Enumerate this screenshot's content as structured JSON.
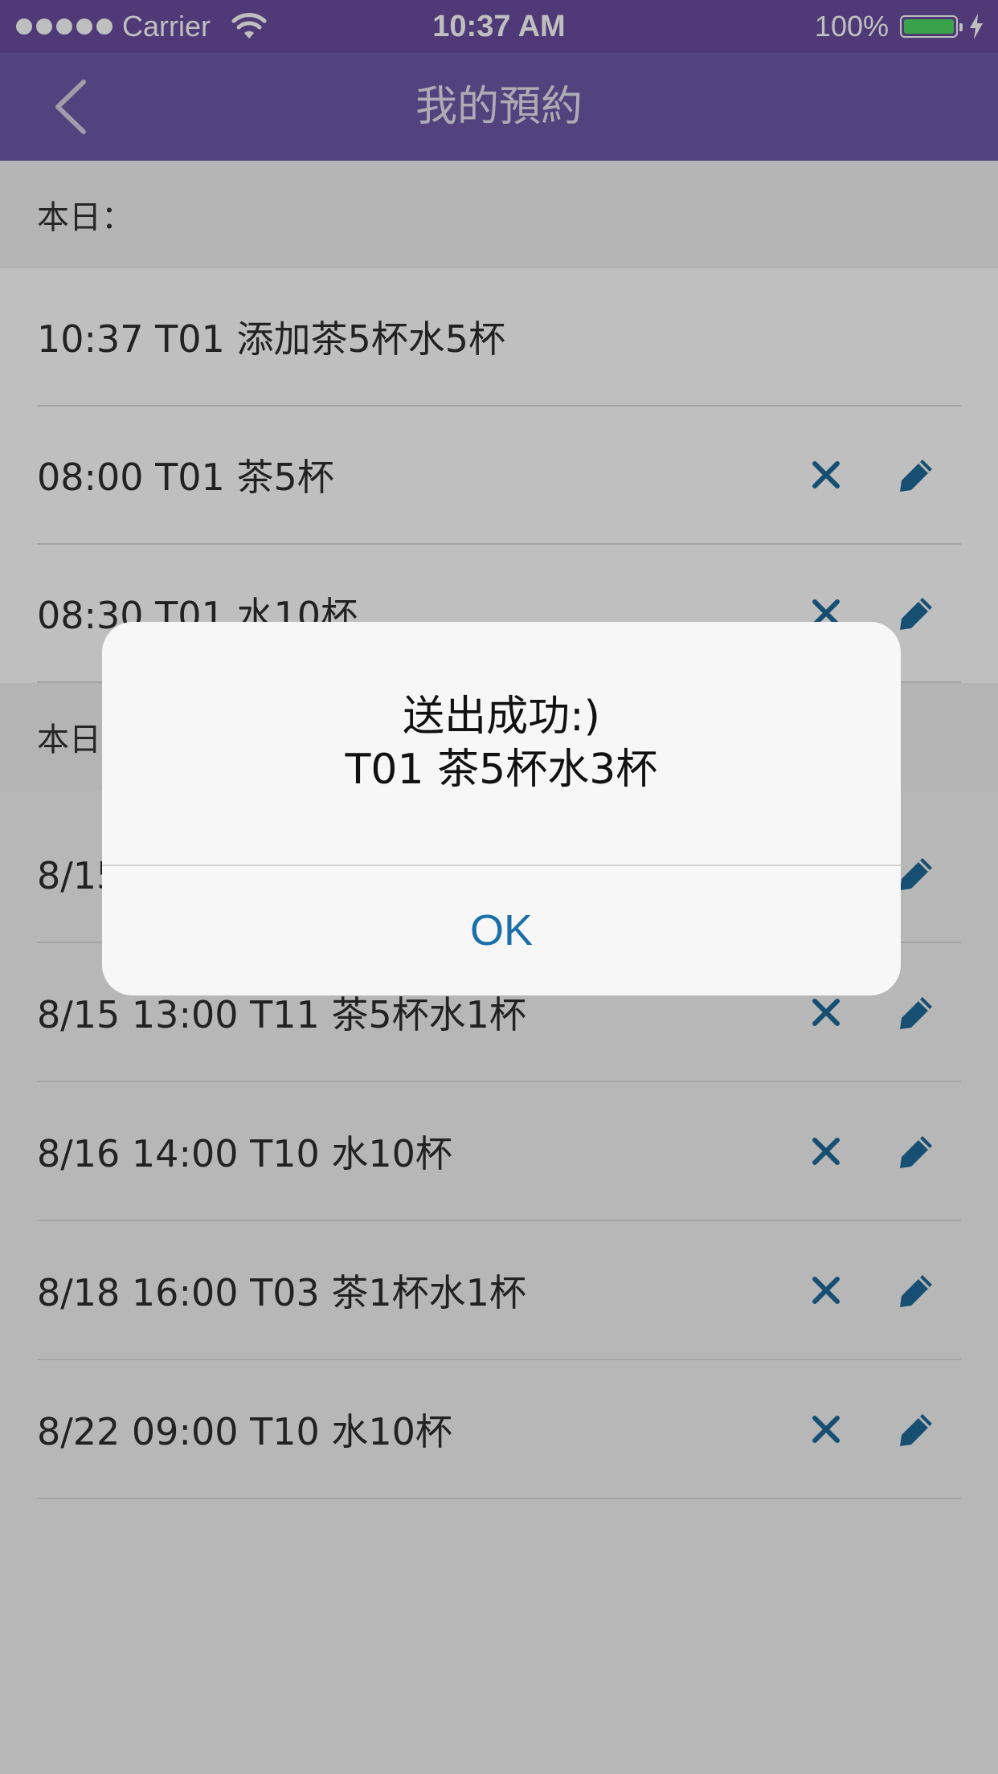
{
  "status_bar": {
    "carrier": "Carrier",
    "time": "10:37 AM",
    "battery": "100%"
  },
  "nav": {
    "title": "我的預約",
    "back_icon": "chevron-left-icon"
  },
  "sections": [
    {
      "header": "本日：",
      "rows": [
        {
          "text": "10:37 T01 添加茶5杯水5杯",
          "actions": false
        },
        {
          "text": "08:00 T01 茶5杯",
          "actions": true
        },
        {
          "text": "08:30 T01 水10杯",
          "actions": true
        }
      ]
    },
    {
      "header": "本日以後：",
      "rows": [
        {
          "text": "8/15 10:00 T01 茶5杯",
          "actions": true
        },
        {
          "text": "8/15 13:00 T11 茶5杯水1杯",
          "actions": true
        },
        {
          "text": "8/16 14:00 T10 水10杯",
          "actions": true
        },
        {
          "text": "8/18 16:00 T03 茶1杯水1杯",
          "actions": true
        },
        {
          "text": "8/22 09:00 T10 水10杯",
          "actions": true
        }
      ]
    }
  ],
  "alert": {
    "line1": "送出成功:)",
    "line2": "T01 茶5杯水3杯",
    "ok_label": "OK"
  },
  "colors": {
    "statusbar": "#6a4c9e",
    "navbar": "#6e5aa8",
    "icon_blue": "#1f6a99",
    "alert_button": "#1b6fa8"
  },
  "icons": [
    "wifi-icon",
    "battery-icon",
    "chevron-left-icon",
    "close-icon",
    "pencil-icon"
  ]
}
